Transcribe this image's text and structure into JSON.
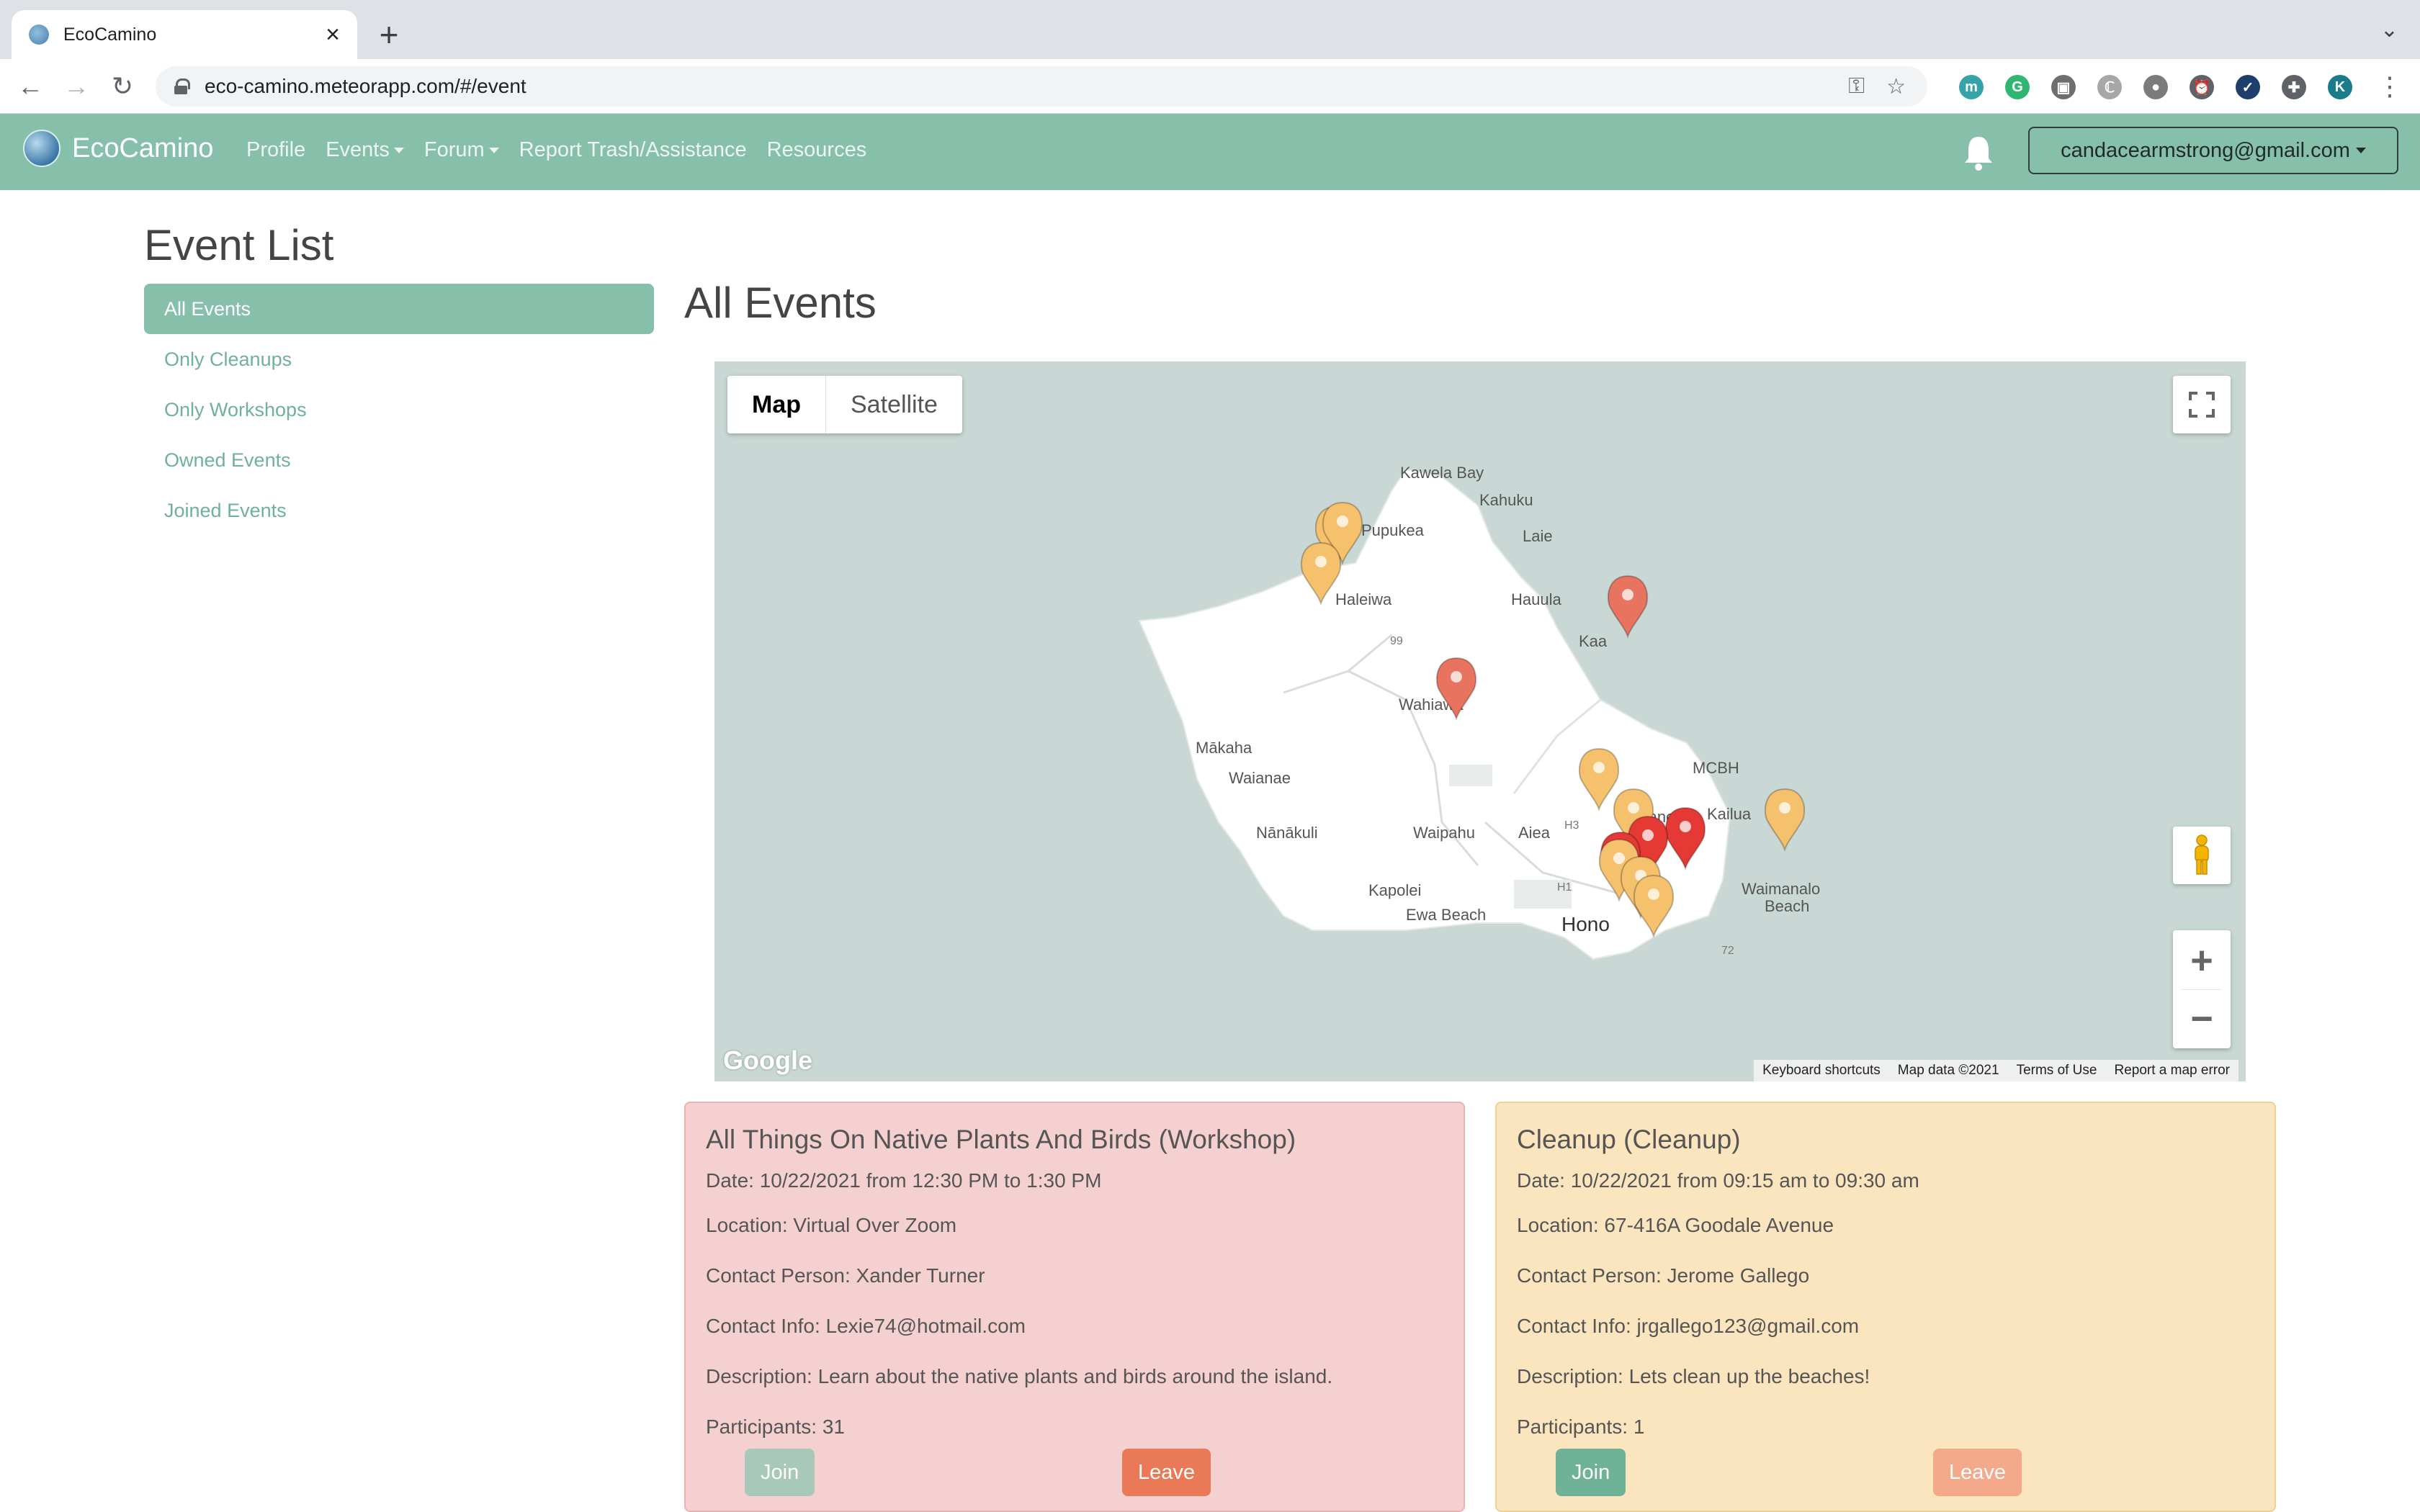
{
  "browser": {
    "tab_title": "EcoCamino",
    "url": "eco-camino.meteorapp.com/#/event",
    "extensions": [
      {
        "name": "meteor-ext-icon",
        "glyph": "m",
        "color": "#36a3a8"
      },
      {
        "name": "grammarly-ext-icon",
        "glyph": "G",
        "color": "#2fb673"
      },
      {
        "name": "ext-3-icon",
        "glyph": "▣",
        "color": "#6e6e6e"
      },
      {
        "name": "ext-4-icon",
        "glyph": "ℂ",
        "color": "#a7a7a7"
      },
      {
        "name": "ext-5-icon",
        "glyph": "●",
        "color": "#7b7b7b"
      },
      {
        "name": "alarm-ext-icon",
        "glyph": "⏰",
        "color": "#5f6368"
      },
      {
        "name": "ext-7-icon",
        "glyph": "✓",
        "color": "#1e3f6b"
      },
      {
        "name": "puzzle-ext-icon",
        "glyph": "✚",
        "color": "#5f6368"
      },
      {
        "name": "profile-avatar",
        "glyph": "K",
        "color": "#1a7b8a"
      }
    ]
  },
  "nav": {
    "brand": "EcoCamino",
    "links": [
      {
        "label": "Profile",
        "dropdown": false
      },
      {
        "label": "Events",
        "dropdown": true
      },
      {
        "label": "Forum",
        "dropdown": true
      },
      {
        "label": "Report Trash/Assistance",
        "dropdown": false
      },
      {
        "label": "Resources",
        "dropdown": false
      }
    ],
    "user": "candacearmstrong@gmail.com"
  },
  "sidebar": {
    "title": "Event List",
    "items": [
      {
        "label": "All Events",
        "active": true
      },
      {
        "label": "Only Cleanups",
        "active": false
      },
      {
        "label": "Only Workshops",
        "active": false
      },
      {
        "label": "Owned Events",
        "active": false
      },
      {
        "label": "Joined Events",
        "active": false
      }
    ]
  },
  "main": {
    "title": "All Events"
  },
  "map": {
    "type_options": [
      "Map",
      "Satellite"
    ],
    "selected_type": "Map",
    "place_labels": [
      "Kawela Bay",
      "Kahuku",
      "Pupukea",
      "Laie",
      "Haleiwa",
      "Hauula",
      "Kaa",
      "Wahiawa",
      "Mākaha",
      "Waianae",
      "MCBH",
      "Kaneohe",
      "Kailua",
      "Nānākuli",
      "Waipahu",
      "Aiea",
      "Waimanalo",
      "Beach",
      "Kapolei",
      "Ewa Beach",
      "Hono",
      "99",
      "H3",
      "H1",
      "72"
    ],
    "google_logo": "Google",
    "attribution": [
      "Keyboard shortcuts",
      "Map data ©2021",
      "Terms of Use",
      "Report a map error"
    ],
    "zoom_in": "+",
    "zoom_out": "−"
  },
  "events": [
    {
      "title": "All Things On Native Plants And Birds (Workshop)",
      "date": "Date: 10/22/2021 from 12:30 PM to 1:30 PM",
      "location": "Location: Virtual Over Zoom",
      "contact_person": "Contact Person: Xander Turner",
      "contact_info": "Contact Info: Lexie74@hotmail.com",
      "description": "Description: Learn about the native plants and birds around the island.",
      "participants": "Participants: 31",
      "join_label": "Join",
      "leave_label": "Leave"
    },
    {
      "title": "Cleanup (Cleanup)",
      "date": "Date: 10/22/2021 from 09:15 am to 09:30 am",
      "location": "Location: 67-416A Goodale Avenue",
      "contact_person": "Contact Person: Jerome Gallego",
      "contact_info": "Contact Info: jrgallego123@gmail.com",
      "description": "Description: Lets clean up the beaches!",
      "participants": "Participants: 1",
      "join_label": "Join",
      "leave_label": "Leave"
    }
  ],
  "colors": {
    "accent": "#87c0aa",
    "workshop_card": "#f5d0d1",
    "cleanup_card": "#fbe5bf",
    "leave_button": "#ea7a57",
    "marker_yellow": "#f5c16c",
    "marker_orange": "#e8735e",
    "marker_red": "#e53935"
  }
}
